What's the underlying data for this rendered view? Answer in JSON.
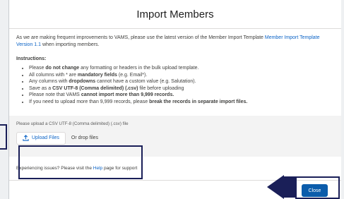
{
  "modal": {
    "title": "Import Members"
  },
  "intro": {
    "text_before": "As we are making frequent improvements to VAMS, please use the latest version of the Member Import Template ",
    "link": "Member Import Template Version 1.1",
    "text_after": " when importing members."
  },
  "instructions": {
    "title": "Instructions:",
    "items": [
      {
        "a": "Please ",
        "b": "do not change",
        "c": " any formatting or headers in the bulk upload template."
      },
      {
        "a": "All columns with * are ",
        "b": "mandatory fields",
        "c": " (e.g. Email*)."
      },
      {
        "a": "Any columns with ",
        "b": "dropdowns",
        "c": " cannot have a custom value (e.g. Salutation)."
      },
      {
        "a": "Save as a ",
        "b": "CSV UTF-8 (Comma delimited) (.csv)",
        "c": " file before uploading"
      },
      {
        "a": "Please note that VAMS ",
        "b": "cannot import more than 9,999 records.",
        "c": ""
      },
      {
        "a": "If you need to upload more than 9,999 records, please ",
        "b": "break the records in separate import files.",
        "c": ""
      }
    ]
  },
  "upload": {
    "hint": "Please upload a CSV UTF-8 (Comma delimited) (.csv) file",
    "button_label": "Upload Files",
    "drop_label": "Or drop files",
    "icon": "upload-icon"
  },
  "help": {
    "text_before": "Experiencing issues? Please visit the ",
    "link": "Help",
    "text_after": " page for support"
  },
  "footer": {
    "close_label": "Close"
  },
  "colors": {
    "accent": "#0b5cab",
    "link": "#0b63c6",
    "annotation": "#1a1f58"
  }
}
